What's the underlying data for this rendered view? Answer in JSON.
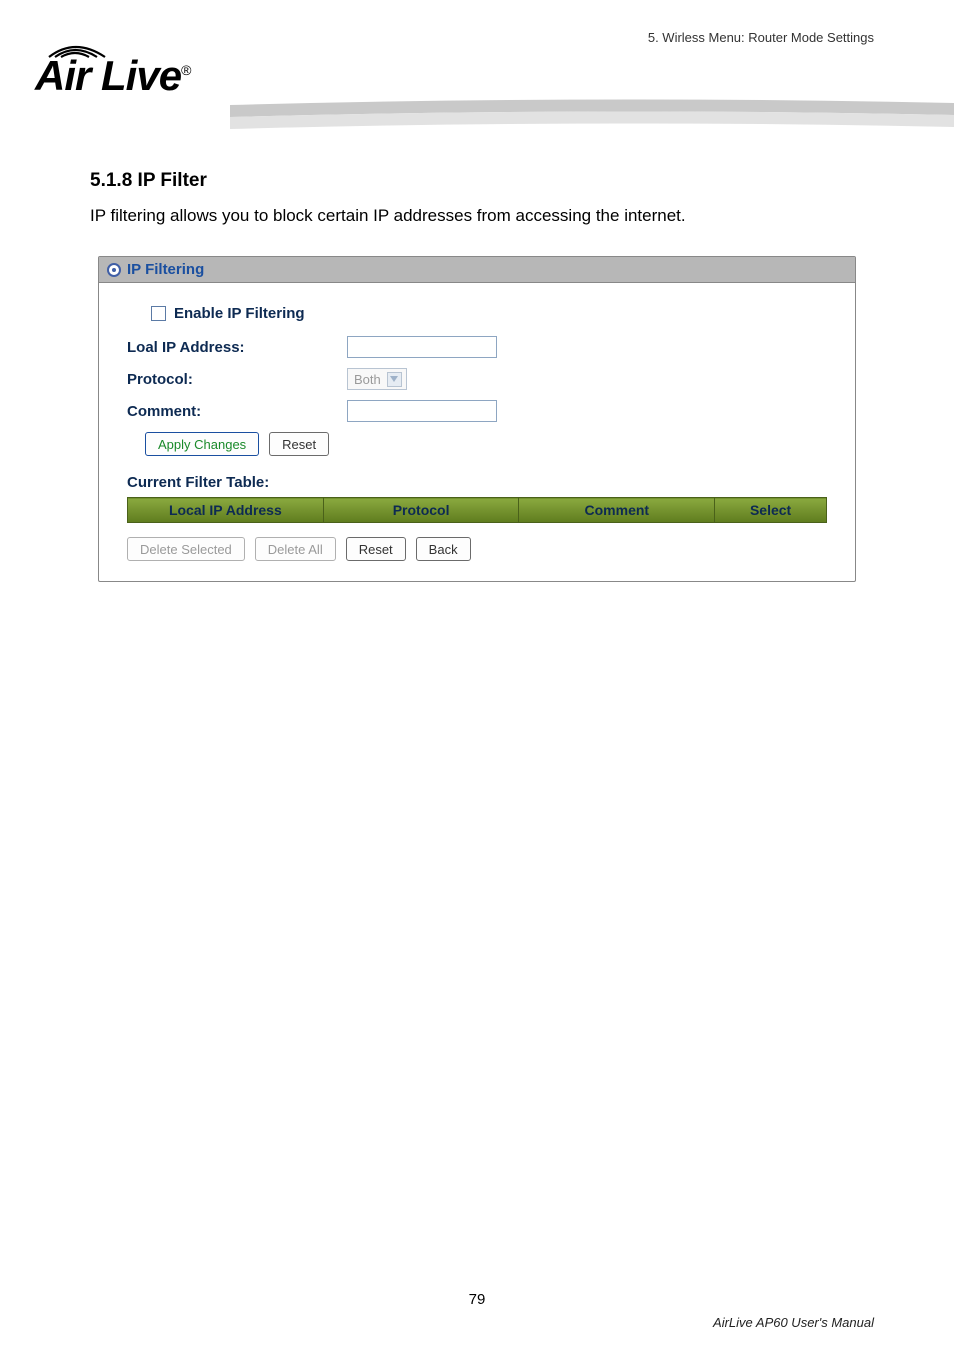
{
  "header": {
    "chapter_ref": "5. Wirless Menu: Router Mode Settings",
    "logo_text": "Air Live",
    "logo_reg": "®"
  },
  "section": {
    "heading": "5.1.8 IP Filter",
    "intro": "IP filtering allows you to block certain IP addresses from accessing the internet."
  },
  "panel": {
    "title": "IP Filtering",
    "enable_label": "Enable IP Filtering",
    "fields": {
      "local_ip_label": "Loal IP Address:",
      "local_ip_value": "",
      "protocol_label": "Protocol:",
      "protocol_selected": "Both",
      "comment_label": "Comment:",
      "comment_value": ""
    },
    "buttons": {
      "apply": "Apply Changes",
      "reset": "Reset"
    },
    "table": {
      "title": "Current Filter Table:",
      "columns": [
        "Local IP Address",
        "Protocol",
        "Comment",
        "Select"
      ],
      "rows": []
    },
    "below_buttons": {
      "delete_selected": "Delete Selected",
      "delete_all": "Delete All",
      "reset": "Reset",
      "back": "Back"
    }
  },
  "footer": {
    "page_number": "79",
    "manual_ref": "AirLive AP60 User's Manual"
  }
}
